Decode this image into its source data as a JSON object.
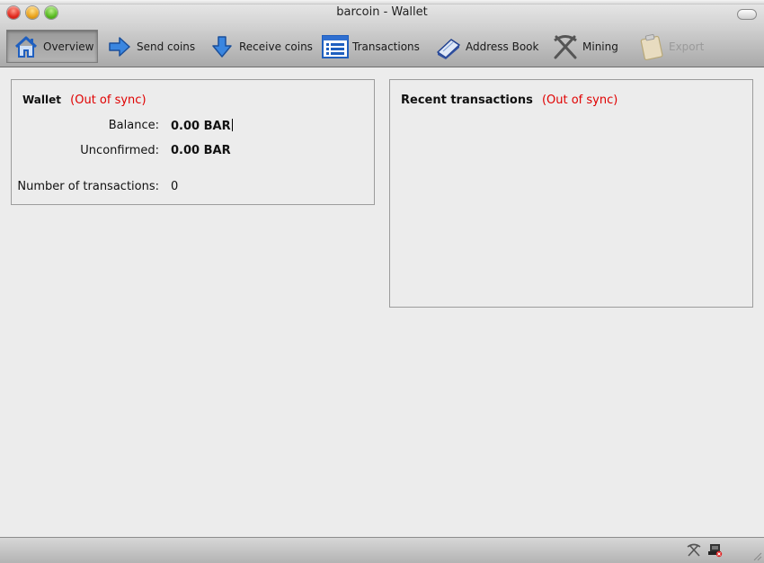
{
  "window": {
    "title": "barcoin - Wallet"
  },
  "toolbar": {
    "items": [
      {
        "label": "Overview",
        "icon": "home-icon",
        "active": true
      },
      {
        "label": "Send coins",
        "icon": "arrow-right-icon"
      },
      {
        "label": "Receive coins",
        "icon": "arrow-down-icon"
      },
      {
        "label": "Transactions",
        "icon": "list-icon"
      },
      {
        "label": "Address Book",
        "icon": "book-icon"
      },
      {
        "label": "Mining",
        "icon": "pickaxe-icon"
      },
      {
        "label": "Export",
        "icon": "clipboard-icon",
        "disabled": true
      }
    ]
  },
  "wallet": {
    "title": "Wallet",
    "sync_status": "(Out of sync)",
    "balance_label": "Balance:",
    "balance_value": "0.00 BAR",
    "unconfirmed_label": "Unconfirmed:",
    "unconfirmed_value": "0.00 BAR",
    "tx_count_label": "Number of transactions:",
    "tx_count_value": "0"
  },
  "recent": {
    "title": "Recent transactions",
    "sync_status": "(Out of sync)"
  },
  "colors": {
    "warning": "#e00000",
    "accent": "#2f6fd0"
  }
}
